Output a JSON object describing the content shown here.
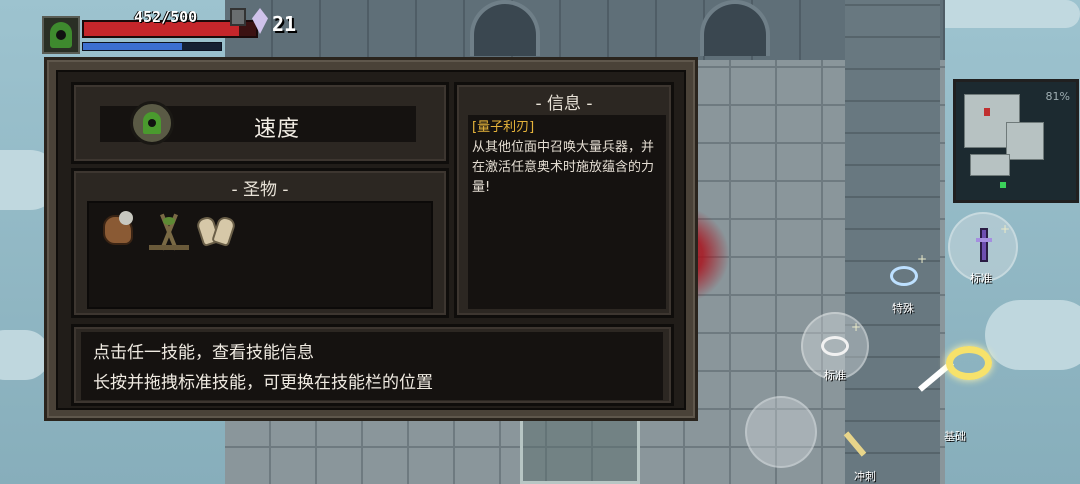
{
  "hud": {
    "hp_text": "452/500",
    "hp_fraction": 0.904,
    "mp_fraction": 0.72,
    "gems": "21"
  },
  "panel": {
    "skill_title": "速度",
    "relics_header": "- 圣物 -",
    "relics": [
      {
        "icon": "horse-head-relic-icon"
      },
      {
        "icon": "tripod-relic-icon"
      },
      {
        "icon": "praying-hands-relic-icon"
      }
    ],
    "info_header": "- 信息 -",
    "info_name": "[量子利刃]",
    "info_desc": "从其他位面中召唤大量兵器，并在激活任意奥术时施放蕴含的力量!",
    "tips": [
      "点击任一技能，查看技能信息",
      "长按并拖拽标准技能，可更换在技能栏的位置"
    ]
  },
  "minimap": {
    "percent": "81%"
  },
  "skills": {
    "standard_top": "标准",
    "special": "特殊",
    "standard_mid": "标准",
    "basic": "基础",
    "dash": "冲刺"
  },
  "colors": {
    "hp": "#c5262b",
    "mp": "#3c6fd1",
    "info_name": "#e5b33a",
    "panel_bg": "#211d19"
  }
}
